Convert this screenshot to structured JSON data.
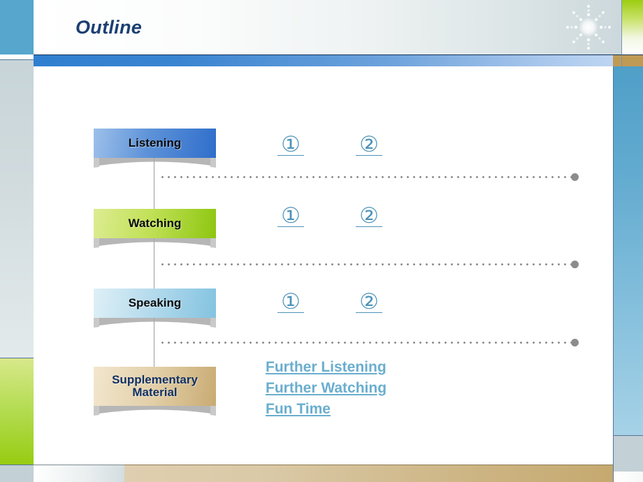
{
  "slide": {
    "title": "Outline",
    "decorations": {
      "sunburst_icon": "sunburst-icon"
    }
  },
  "sections": [
    {
      "key": "listening",
      "label": "Listening",
      "items": [
        {
          "glyph": "①",
          "name": "listening-item-1"
        },
        {
          "glyph": "②",
          "name": "listening-item-2"
        }
      ]
    },
    {
      "key": "watching",
      "label": "Watching",
      "items": [
        {
          "glyph": "①",
          "name": "watching-item-1"
        },
        {
          "glyph": "②",
          "name": "watching-item-2"
        }
      ]
    },
    {
      "key": "speaking",
      "label": "Speaking",
      "items": [
        {
          "glyph": "①",
          "name": "speaking-item-1"
        },
        {
          "glyph": "②",
          "name": "speaking-item-2"
        }
      ]
    },
    {
      "key": "supplementary",
      "label": "Supplementary\nMaterial",
      "items": []
    }
  ],
  "links": [
    {
      "label": "Further Listening",
      "name": "link-further-listening"
    },
    {
      "label": "Further Watching",
      "name": "link-further-watching"
    },
    {
      "label": "Fun Time",
      "name": "link-fun-time"
    }
  ],
  "colors": {
    "title_text": "#1b3f73",
    "title_bar_accent": "#2f7fd0",
    "listening_banner": "#2f6ecb",
    "watching_banner": "#8dc610",
    "speaking_banner": "#83c3e0",
    "supplementary_banner": "#c9ab73",
    "supplementary_text": "#123163",
    "number_circle": "#4e93b8",
    "link_text": "#6aaece",
    "dotted_rule": "#8c8c8c",
    "left_panel_green": "#96cc11",
    "right_panel_blue": "#4f9fc8",
    "bottom_bar_gold": "#cdb584"
  }
}
